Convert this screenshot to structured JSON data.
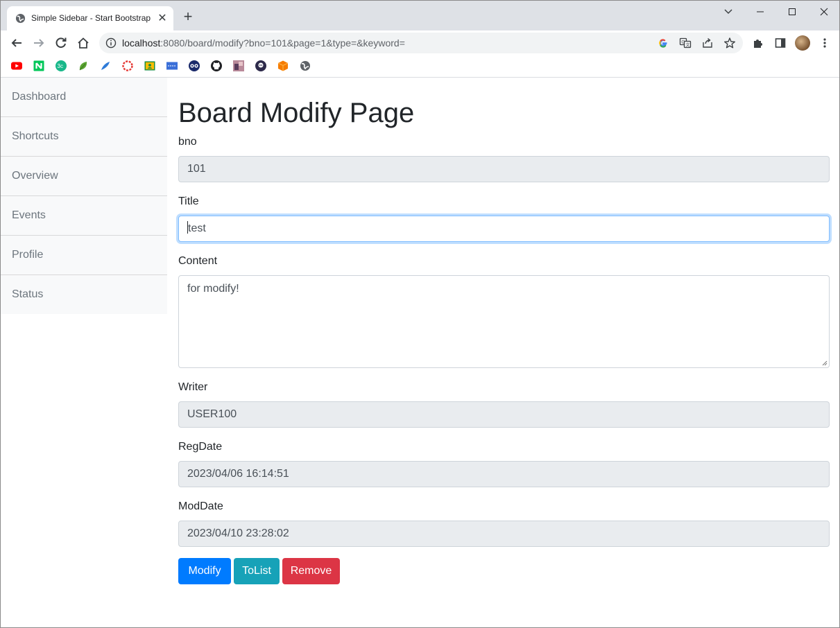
{
  "browser": {
    "tab_title": "Simple Sidebar - Start Bootstrap",
    "tab_close": "✕",
    "new_tab": "+",
    "url_host": "localhost",
    "url_rest": ":8080/board/modify?bno=101&page=1&type=&keyword=",
    "window_controls": [
      "chevron-down",
      "minimize",
      "maximize",
      "close"
    ],
    "bookmarks": [
      "youtube",
      "naver",
      "green-app",
      "leaf",
      "feather",
      "ring",
      "classroom",
      "bank",
      "owl",
      "github",
      "photo",
      "avatar-bot",
      "orange-cube",
      "globe"
    ]
  },
  "sidebar": {
    "items": [
      {
        "label": "Dashboard"
      },
      {
        "label": "Shortcuts"
      },
      {
        "label": "Overview"
      },
      {
        "label": "Events"
      },
      {
        "label": "Profile"
      },
      {
        "label": "Status"
      }
    ]
  },
  "form": {
    "page_title": "Board Modify Page",
    "bno": {
      "label": "bno",
      "value": "101"
    },
    "title": {
      "label": "Title",
      "value": "test"
    },
    "content": {
      "label": "Content",
      "value": "for modify!"
    },
    "writer": {
      "label": "Writer",
      "value": "USER100"
    },
    "regdate": {
      "label": "RegDate",
      "value": "2023/04/06 16:14:51"
    },
    "moddate": {
      "label": "ModDate",
      "value": "2023/04/10 23:28:02"
    }
  },
  "buttons": {
    "modify": {
      "label": "Modify",
      "color": "#007bff"
    },
    "tolist": {
      "label": "ToList",
      "color": "#17a2b8"
    },
    "remove": {
      "label": "Remove",
      "color": "#dc3545"
    }
  }
}
